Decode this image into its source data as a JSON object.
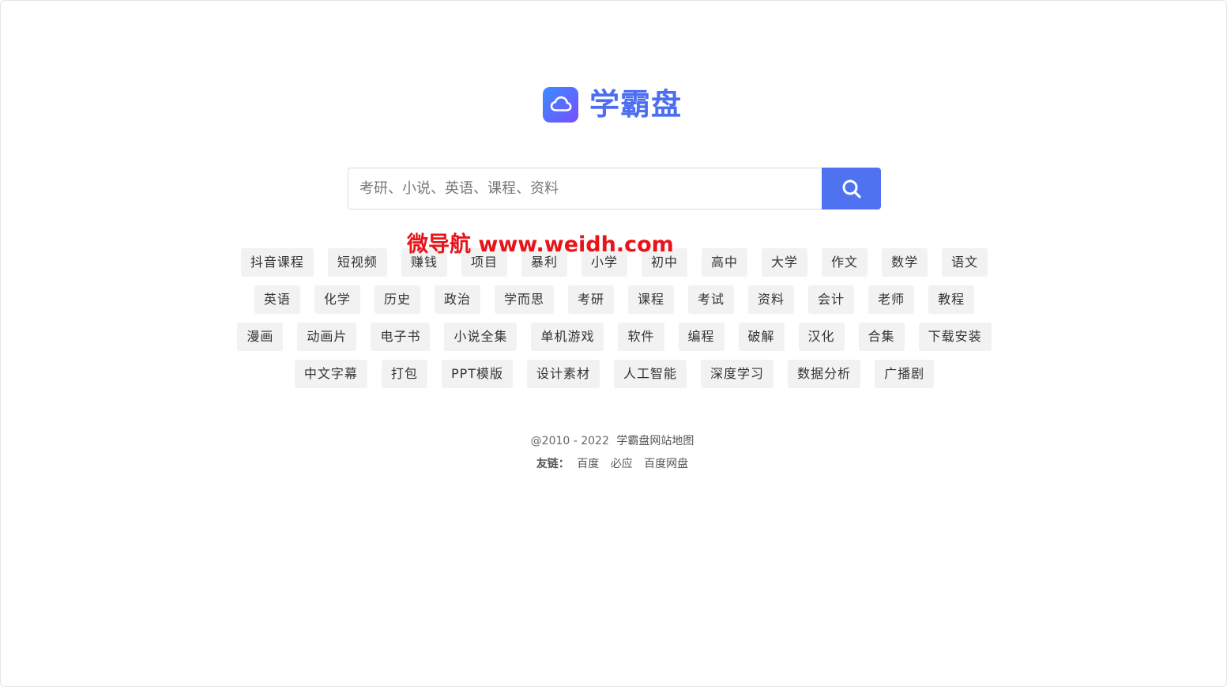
{
  "brand": {
    "name": "学霸盘",
    "icon": "cloud-icon",
    "color": "#4d6ef0"
  },
  "search": {
    "placeholder": "考研、小说、英语、课程、资料",
    "value": "",
    "button_icon": "search-icon",
    "button_color": "#4f72f0"
  },
  "watermark": {
    "text": "微导航 www.weidh.com",
    "color": "#e8141a"
  },
  "tags": {
    "row1": [
      "抖音课程",
      "短视频",
      "赚钱",
      "项目",
      "暴利",
      "小学",
      "初中",
      "高中",
      "大学",
      "作文",
      "数学",
      "语文"
    ],
    "row2": [
      "英语",
      "化学",
      "历史",
      "政治",
      "学而思",
      "考研",
      "课程",
      "考试",
      "资料",
      "会计",
      "老师",
      "教程"
    ],
    "row3": [
      "漫画",
      "动画片",
      "电子书",
      "小说全集",
      "单机游戏",
      "软件",
      "编程",
      "破解",
      "汉化",
      "合集",
      "下载安装"
    ],
    "row4": [
      "中文字幕",
      "打包",
      "PPT模版",
      "设计素材",
      "人工智能",
      "深度学习",
      "数据分析",
      "广播剧"
    ]
  },
  "footer": {
    "copyright": "@2010 - 2022",
    "sitemap": "学霸盘网站地图",
    "friend_label": "友链：",
    "friend_links": [
      "百度",
      "必应",
      "百度网盘"
    ]
  }
}
